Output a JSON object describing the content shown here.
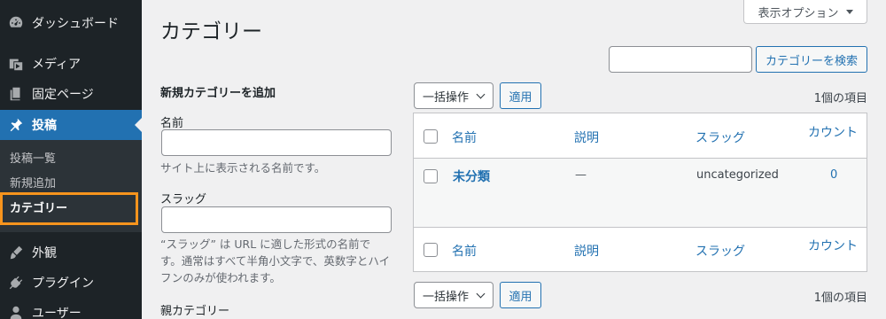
{
  "sidebar": {
    "items": [
      {
        "label": "ダッシュボード",
        "icon": "dashboard-icon"
      },
      {
        "label": "メディア",
        "icon": "media-icon"
      },
      {
        "label": "固定ページ",
        "icon": "page-icon"
      },
      {
        "label": "投稿",
        "icon": "pin-icon"
      },
      {
        "label": "外観",
        "icon": "brush-icon"
      },
      {
        "label": "プラグイン",
        "icon": "plugin-icon"
      },
      {
        "label": "ユーザー",
        "icon": "user-icon"
      }
    ],
    "submenu": [
      "投稿一覧",
      "新規追加",
      "カテゴリー"
    ]
  },
  "header": {
    "screen_options": "表示オプション",
    "title": "カテゴリー",
    "search_button": "カテゴリーを検索"
  },
  "form": {
    "heading": "新規カテゴリーを追加",
    "name_label": "名前",
    "name_desc": "サイト上に表示される名前です。",
    "slug_label": "スラッグ",
    "slug_desc": "“スラッグ” は URL に適した形式の名前です。通常はすべて半角小文字で、英数字とハイフンのみが使われます。",
    "parent_label": "親カテゴリー"
  },
  "table": {
    "bulk_action": "一括操作",
    "apply": "適用",
    "count": "1個の項目",
    "columns": [
      "名前",
      "説明",
      "スラッグ",
      "カウント"
    ],
    "rows": [
      {
        "name": "未分類",
        "description": "—",
        "slug": "uncategorized",
        "count": "0"
      }
    ]
  },
  "colors": {
    "sidebar_bg": "#1d2327",
    "accent": "#2271b1",
    "highlight": "#f7941d"
  }
}
